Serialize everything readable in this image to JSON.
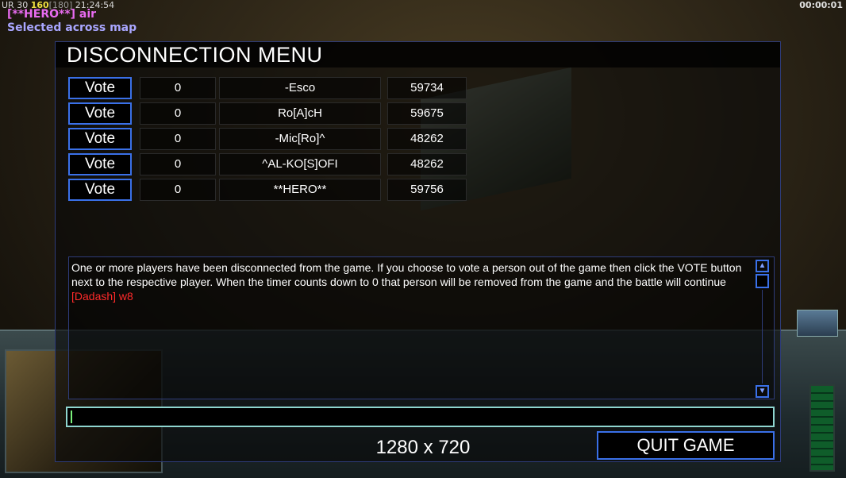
{
  "overlay": {
    "stats_prefix": "UR 30",
    "stats_highlight": "160",
    "stats_dim": "[180]",
    "stats_time": "21:24:54",
    "clock": "00:00:01",
    "chat_line": "[**HERO**] air",
    "chat_line2": "Selected across map"
  },
  "dialog": {
    "title": "DISCONNECTION MENU",
    "players": [
      {
        "vote_label": "Vote",
        "count": "0",
        "name": "-Esco",
        "ping": "59734"
      },
      {
        "vote_label": "Vote",
        "count": "0",
        "name": "Ro[A]cH",
        "ping": "59675"
      },
      {
        "vote_label": "Vote",
        "count": "0",
        "name": "-Mic[Ro]^",
        "ping": "48262"
      },
      {
        "vote_label": "Vote",
        "count": "0",
        "name": "^AL-KO[S]OFI",
        "ping": "48262"
      },
      {
        "vote_label": "Vote",
        "count": "0",
        "name": "**HERO**",
        "ping": "59756"
      }
    ],
    "message": "One or more players have been disconnected from the game. If you choose to vote a person out of the game then click the VOTE button next to the respective player. When the timer counts down to 0 that person will be removed from the game and the battle will continue",
    "chat_message": "[Dadash] w8",
    "quit_label": "QUIT GAME"
  },
  "resolution_label": "1280 x 720",
  "colors": {
    "button_border": "#3a70e8",
    "chat_red": "#ff2a2a",
    "input_border": "#8fd6d0"
  }
}
